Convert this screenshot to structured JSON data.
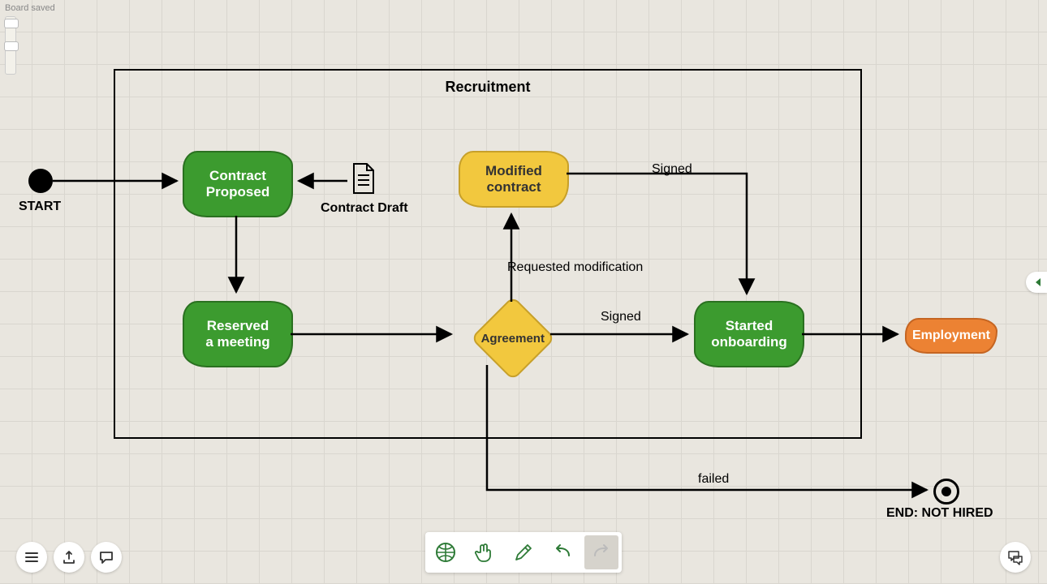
{
  "status": "Board saved",
  "diagram": {
    "containerTitle": "Recruitment",
    "startLabel": "START",
    "endLabel": "END: NOT HIRED",
    "contractDraftLabel": "Contract Draft",
    "nodes": {
      "contractProposed": "Contract\nProposed",
      "reservedMeeting": "Reserved\na meeting",
      "modifiedContract": "Modified\ncontract",
      "agreement": "Agreement",
      "startedOnboarding": "Started\nonboarding",
      "employment": "Employment"
    },
    "edges": {
      "requestedModification": "Requested modification",
      "signedTop": "Signed",
      "signedMid": "Signed",
      "failed": "failed"
    }
  },
  "toolbar": {
    "globe": "globe-icon",
    "hand": "hand-icon",
    "pencil": "pencil-icon",
    "undo": "undo-icon",
    "redo": "redo-icon"
  },
  "leftButtons": {
    "a": "list-icon",
    "b": "export-icon",
    "c": "comment-icon"
  },
  "chatButton": "chat-icon"
}
